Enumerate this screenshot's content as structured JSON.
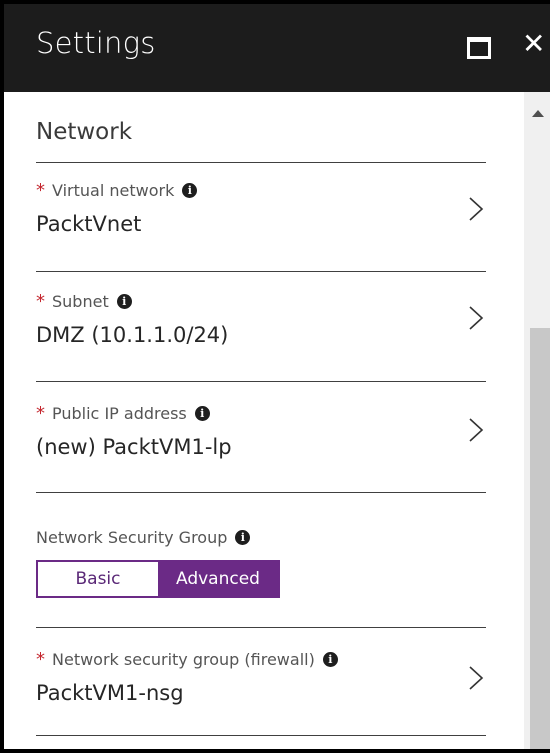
{
  "window": {
    "title": "Settings",
    "maximize_icon": "maximize-icon",
    "close_glyph": "✕",
    "close_icon": "close-icon"
  },
  "section": {
    "title": "Network"
  },
  "fields": [
    {
      "label": "Virtual network",
      "required": "*",
      "value": "PacktVnet",
      "info": "i"
    },
    {
      "label": "Subnet",
      "required": "*",
      "value": "DMZ (10.1.1.0/24)",
      "info": "i"
    },
    {
      "label": "Public IP address",
      "required": "*",
      "value": "(new) PacktVM1-lp",
      "info": "i"
    }
  ],
  "nsg_group": {
    "label": "Network Security Group",
    "info": "i",
    "options": [
      "Basic",
      "Advanced"
    ],
    "selected": "Advanced"
  },
  "nsg_field": {
    "label": "Network security group (firewall)",
    "required": "*",
    "value": "PacktVM1-nsg",
    "info": "i"
  },
  "colors": {
    "titlebar": "#1c1c1c",
    "required": "#c4262e",
    "accent": "#6b2a86",
    "scrollbar_track": "#f0f0f0",
    "scrollbar_thumb": "#c8c8c8"
  }
}
